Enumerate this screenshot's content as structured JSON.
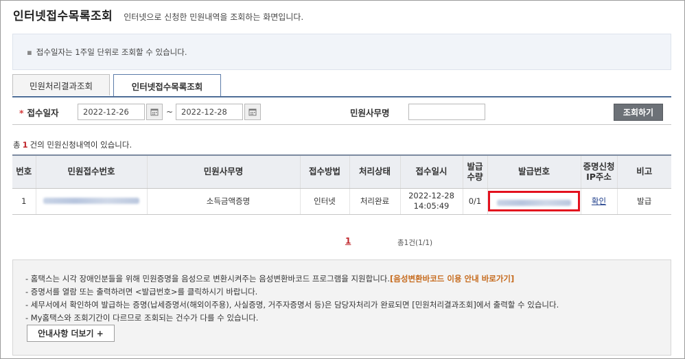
{
  "header": {
    "title": "인터넷접수목록조회",
    "description": "인터넷으로 신청한 민원내역을 조회하는 화면입니다."
  },
  "notice": {
    "text": "접수일자는 1주일 단위로 조회할 수 있습니다."
  },
  "tabs": [
    {
      "label": "민원처리결과조회",
      "active": false
    },
    {
      "label": "인터넷접수목록조회",
      "active": true
    }
  ],
  "search": {
    "date_label": "접수일자",
    "required_mark": "*",
    "date_from": "2022-12-26",
    "separator": "~",
    "date_to": "2022-12-28",
    "name_label": "민원사무명",
    "name_value": "",
    "button_label": "조회하기"
  },
  "summary": {
    "prefix": "총",
    "count": "1",
    "suffix": "건의 민원신청내역이 있습니다."
  },
  "table": {
    "headers": [
      "번호",
      "민원접수번호",
      "민원사무명",
      "접수방법",
      "처리상태",
      "접수일시",
      "발급 수량",
      "발급번호",
      "증명신청 IP주소",
      "비고"
    ],
    "rows": [
      {
        "no": "1",
        "receipt_no": "",
        "service_name": "소득금액증명",
        "method": "인터넷",
        "status": "처리완료",
        "date": "2022-12-28",
        "time": "14:05:49",
        "quantity": "0/1",
        "issue_no": "",
        "ip_link": "확인",
        "note": "발급"
      }
    ]
  },
  "pagination": {
    "current": "1",
    "info": "총1건(1/1)"
  },
  "guide": {
    "items": [
      "- 홈택스는 시각 장애인분들을 위해 민원증명을 음성으로 변환시켜주는 음성변환바코드 프로그램을 지원합니다.",
      "- 증명서를 열람 또는 출력하려면 <발급번호>를 클릭하시기 바랍니다.",
      "- 세무서에서 확인하여 발급하는 증명(납세증명서(해외이주용), 사실증명, 거주자증명서 등)은 담당자처리가 완료되면 [민원처리결과조회]에서 출력할 수 있습니다.",
      "- My홈택스와 조회기간이 다르므로 조회되는 건수가 다를 수 있습니다."
    ],
    "barcode_link": "[음성변환바코드 이용 안내 바로가기]",
    "more_button": "안내사항 더보기 +"
  },
  "icons": {
    "calendar": "calendar-icon",
    "bullet": "bullet-icon"
  },
  "colors": {
    "accent_red": "#c0282d",
    "highlight_box": "#e3101d",
    "tab_line": "#4e6d97",
    "guide_link": "#c66a1c"
  }
}
